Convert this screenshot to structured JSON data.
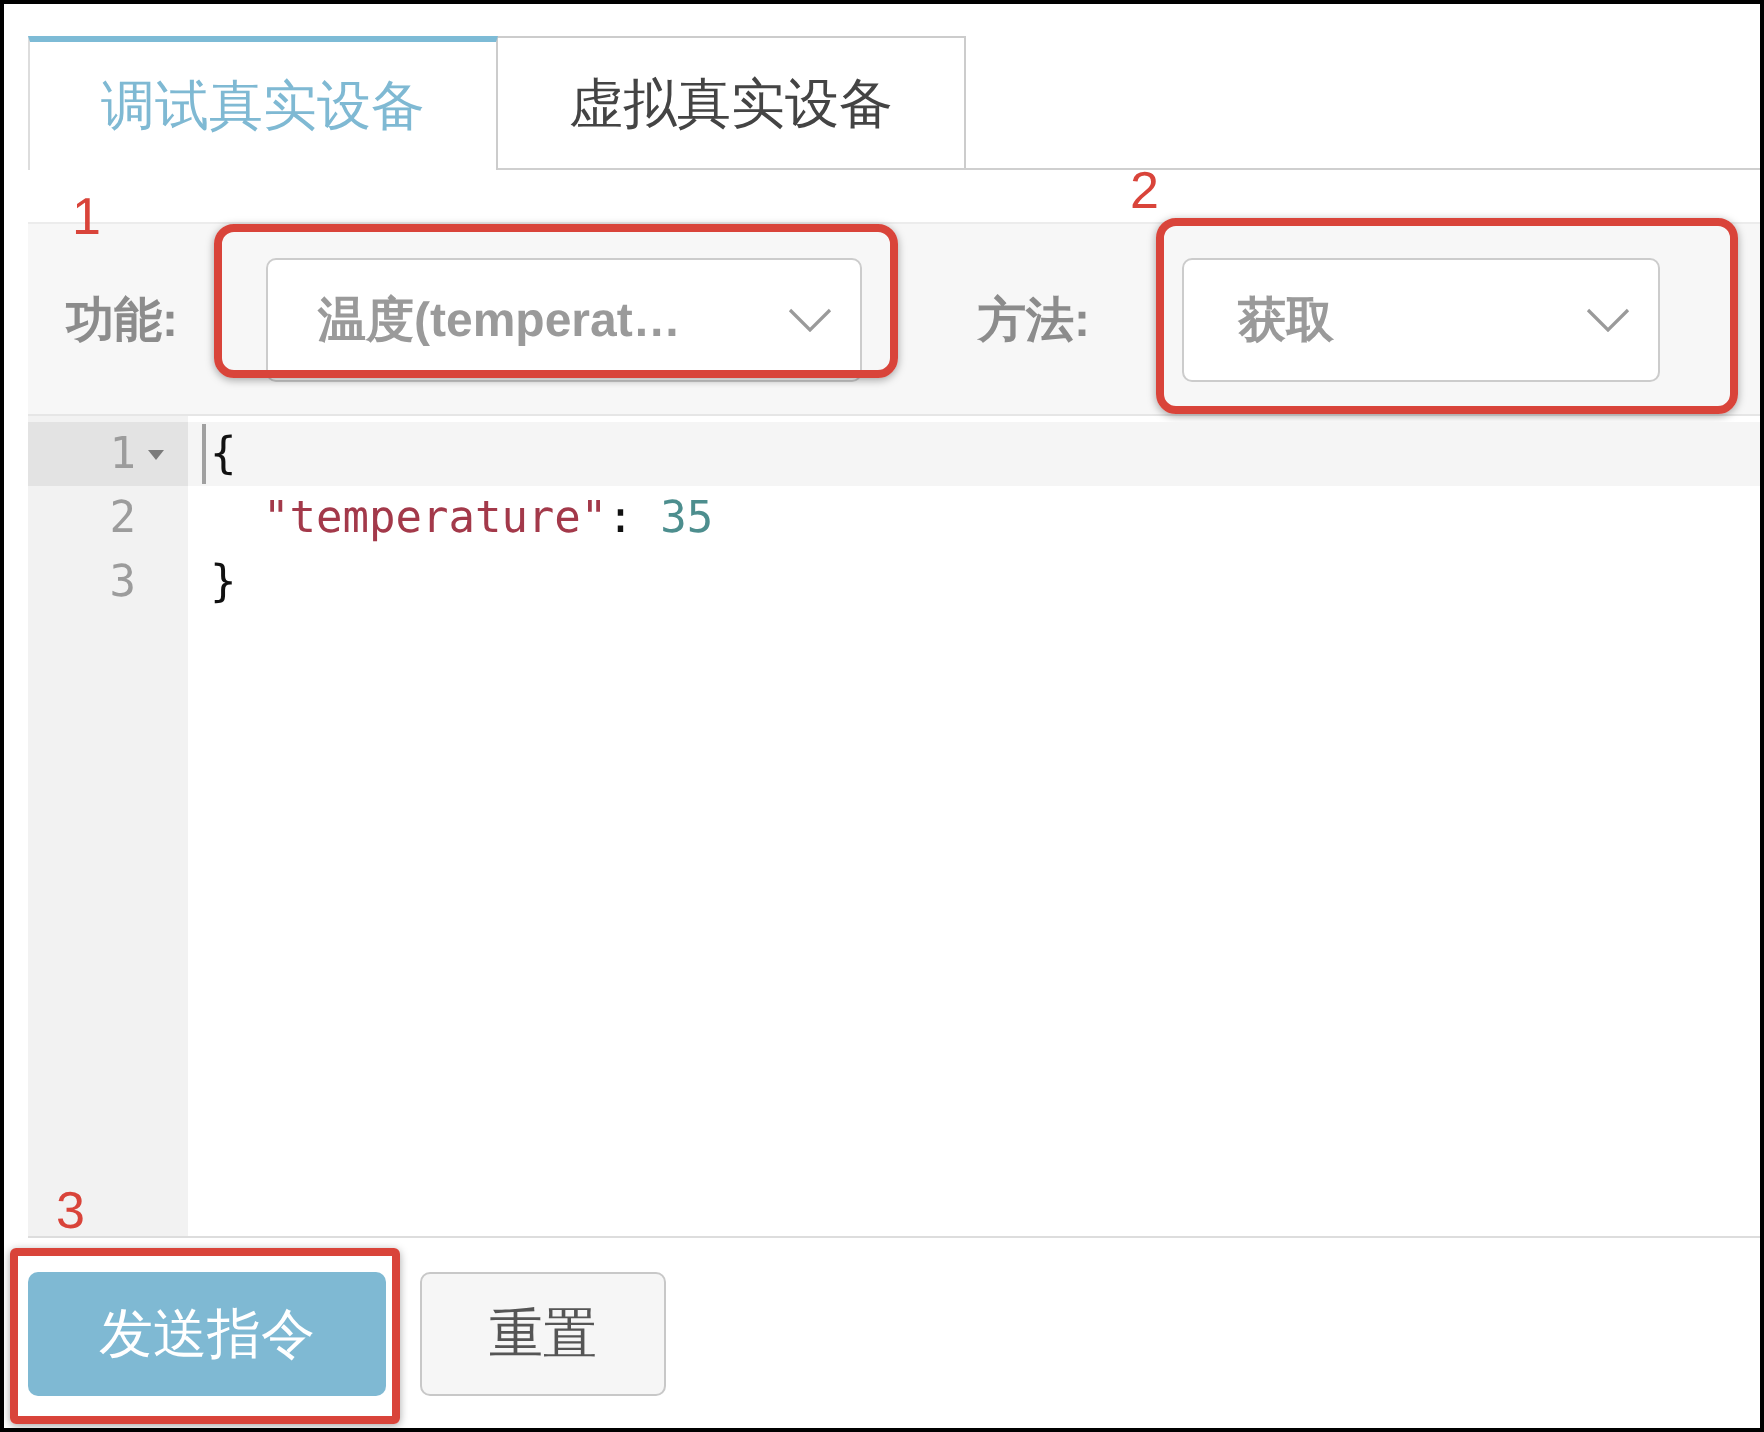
{
  "tabs": [
    {
      "label": "调试真实设备",
      "selected": true
    },
    {
      "label": "虚拟真实设备",
      "selected": false
    }
  ],
  "toolbar": {
    "fields": [
      {
        "label": "功能:",
        "value": "温度(temperat…",
        "annotation": "1"
      },
      {
        "label": "方法:",
        "value": "获取",
        "annotation": "2"
      }
    ]
  },
  "editor": {
    "lines": [
      {
        "number": "1",
        "active": true,
        "foldable": true,
        "tokens": [
          {
            "kind": "punct",
            "text": "{"
          }
        ],
        "children": [
          {
            "number": "2",
            "active": false,
            "foldable": false,
            "tokens": [
              {
                "kind": "key",
                "text": "\"temperature\""
              },
              {
                "kind": "punct",
                "text": ": "
              },
              {
                "kind": "number",
                "text": "35"
              }
            ]
          }
        ]
      },
      {
        "number": "3",
        "active": false,
        "foldable": false,
        "tokens": [
          {
            "kind": "punct",
            "text": "}"
          }
        ]
      }
    ]
  },
  "buttons": [
    {
      "label": "发送指令",
      "kind": "primary",
      "annotation": "3"
    },
    {
      "label": "重置",
      "kind": "default"
    }
  ]
}
